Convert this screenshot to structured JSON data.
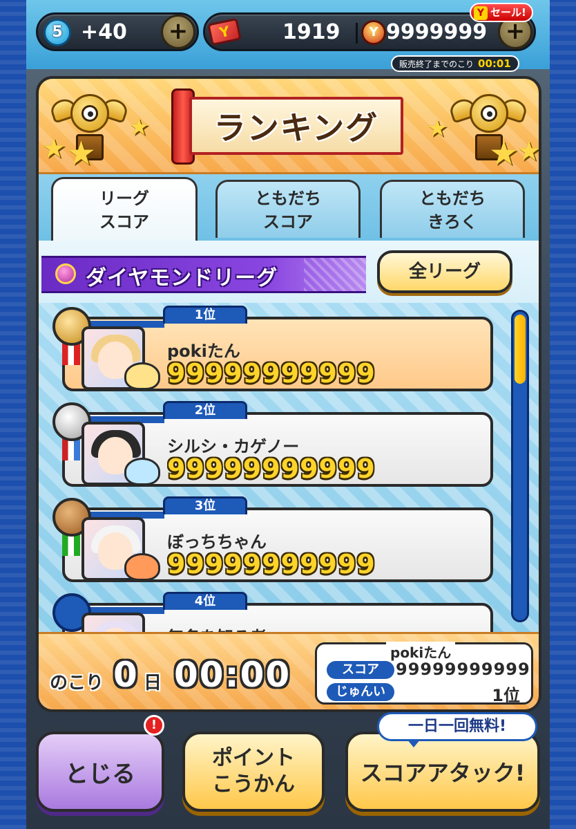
{
  "topbar": {
    "stamina_level": "5",
    "stamina_plus": "+40",
    "gems": "1919",
    "coins": "9999999",
    "sale_badge": "セール!",
    "sale_badge_icon": "Y",
    "sale_timer_label": "販売終了までのこり",
    "sale_timer_value": "00:01",
    "plus_symbol": "+"
  },
  "header": {
    "title": "ランキング"
  },
  "tabs": [
    {
      "label_line1": "リーグ",
      "label_line2": "スコア",
      "active": true
    },
    {
      "label_line1": "ともだち",
      "label_line2": "スコア",
      "active": false
    },
    {
      "label_line1": "ともだち",
      "label_line2": "きろく",
      "active": false
    }
  ],
  "league": {
    "name": "ダイヤモンドリーグ",
    "all_button": "全リーグ"
  },
  "ranking": [
    {
      "rank": "1位",
      "name": "pokiたん",
      "score": "99999999999",
      "medal": "gold",
      "highlight": true
    },
    {
      "rank": "2位",
      "name": "シルシ・カゲノー",
      "score": "99999999999",
      "medal": "silver",
      "highlight": false
    },
    {
      "rank": "3位",
      "name": "ぼっちちゃん",
      "score": "99999999999",
      "medal": "bronze",
      "highlight": false
    },
    {
      "rank": "4位",
      "name": "無名を知る者",
      "score": "",
      "medal": "none",
      "highlight": false
    }
  ],
  "remaining": {
    "label": "のこり",
    "days": "0",
    "day_unit": "日",
    "time": "00:00"
  },
  "my_record": {
    "name": "pokiたん",
    "score_label": "スコア",
    "score": "99999999999",
    "rank_label": "じゅんい",
    "rank": "1位"
  },
  "buttons": {
    "close": "とじる",
    "points_line1": "ポイント",
    "points_line2": "こうかん",
    "attack": "スコアアタック!",
    "free_bubble": "一日一回無料!",
    "notify": "!"
  },
  "colors": {
    "accent_blue": "#1e5ab8",
    "gold_text": "#ffd42a",
    "league_purple": "#7a38d4"
  }
}
